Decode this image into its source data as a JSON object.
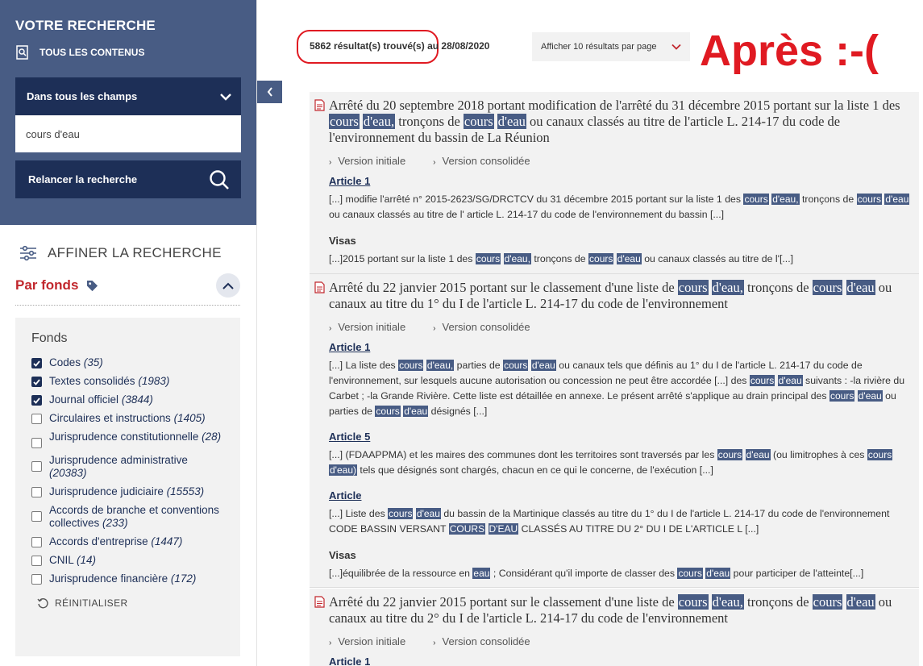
{
  "sidebar": {
    "title": "VOTRE RECHERCHE",
    "scope": "TOUS LES CONTENUS",
    "field_select": "Dans tous les champs",
    "search_value": "cours d'eau",
    "relaunch": "Relancer la recherche",
    "refine": "AFFINER LA RECHERCHE",
    "fonds_label": "Par fonds",
    "box_title": "Fonds",
    "reset": "RÉINITIALISER",
    "items": [
      {
        "label": "Codes",
        "count": "(35)",
        "checked": true
      },
      {
        "label": "Textes consolidés",
        "count": "(1983)",
        "checked": true
      },
      {
        "label": "Journal officiel",
        "count": "(3844)",
        "checked": true
      },
      {
        "label": "Circulaires et instructions",
        "count": "(1405)",
        "checked": false
      },
      {
        "label": "Jurisprudence constitutionnelle",
        "count": "(28)",
        "checked": false
      },
      {
        "label": "Jurisprudence administrative",
        "count": "(20383)",
        "checked": false
      },
      {
        "label": "Jurisprudence judiciaire",
        "count": "(15553)",
        "checked": false
      },
      {
        "label": "Accords de branche et conventions collectives",
        "count": "(233)",
        "checked": false
      },
      {
        "label": "Accords d'entreprise",
        "count": "(1447)",
        "checked": false
      },
      {
        "label": "CNIL",
        "count": "(14)",
        "checked": false
      },
      {
        "label": "Jurisprudence financière",
        "count": "(172)",
        "checked": false
      }
    ]
  },
  "header": {
    "count": "5862 résultat(s) trouvé(s)",
    "date": "au 28/08/2020",
    "perpage": "Afficher 10 résultats par page",
    "annotation": "Après :-("
  },
  "versions": {
    "initial": "Version initiale",
    "consolidated": "Version consolidée"
  },
  "results": [
    {
      "title_a": "Arrêté du 20 septembre 2018 portant modification de l'arrêté du 31 décembre 2015 portant sur la liste 1 des ",
      "title_b": " tronçons de ",
      "title_c": " ou canaux classés au titre de l'article L. 214-17 du code de l'environnement du bassin de La Réunion",
      "hl_cours": "cours",
      "hl_deau_comma": "d'eau,",
      "hl_deau": "d'eau",
      "art1": "Article 1",
      "ex1_a": "[...] modifie l'arrêté n° 2015-2623/SG/DRCTCV du 31 décembre 2015 portant sur la liste 1 des ",
      "ex1_b": " tronçons de ",
      "ex1_c": " ou canaux classés au titre de l' article L. 214-17 du code de l'environnement du bassin [...]",
      "visas": "Visas",
      "ex2_a": "[...]2015 portant sur la liste 1 des ",
      "ex2_b": " tronçons de ",
      "ex2_c": " ou canaux classés au titre de l'[...]"
    },
    {
      "title_a": "Arrêté du 22 janvier 2015 portant sur le classement d'une liste de ",
      "title_b": " tronçons de ",
      "title_c": " ou canaux au titre du 1° du I de l'article L. 214-17 du code de l'environnement",
      "art1": "Article 1",
      "ex1_a": "[...] La liste des ",
      "ex1_b": " parties de ",
      "ex1_c": " ou canaux tels que définis au 1° du I de l'article L. 214-17 du code de l'environnement, sur lesquels aucune autorisation ou concession ne peut être accordée [...] des ",
      "ex1_d": " suivants : -la rivière du Carbet ; -la Grande Rivière. Cette liste est détaillée en annexe. Le présent arrêté s'applique au drain principal des ",
      "ex1_e": " ou parties de ",
      "ex1_f": " désignés [...]",
      "art5": "Article 5",
      "ex2_a": "[...] (FDAAPPMA) et les maires des communes dont les territoires sont traversés par les ",
      "ex2_b": " (ou limitrophes à ces ",
      "hl_deau_paren": "d'eau)",
      "ex2_c": " tels que désignés sont chargés, chacun en ce qui le concerne, de l'exécution [...]",
      "art": "Article",
      "ex3_a": "[...] Liste des ",
      "ex3_b": " du bassin de la Martinique classés au titre du 1° du I de l'article L. 214-17 du code de l'environnement CODE BASSIN VERSANT ",
      "hl_COURS": "COURS",
      "hl_DEAU": "D'EAU",
      "ex3_c": " CLASSÉS AU TITRE DU 2° DU I DE L'ARTICLE L [...]",
      "visas": "Visas",
      "ex4_a": "[...]équilibrée de la ressource en ",
      "hl_eau": "eau",
      "ex4_b": " ; Considérant qu'il importe de classer des ",
      "ex4_c": " pour participer de l'atteinte[...]"
    },
    {
      "title_a": "Arrêté du 22 janvier 2015 portant sur le classement d'une liste de ",
      "title_b": " tronçons de ",
      "title_c": " ou canaux au titre du 2° du I de l'article L. 214-17 du code de l'environnement",
      "art1": "Article 1"
    }
  ]
}
